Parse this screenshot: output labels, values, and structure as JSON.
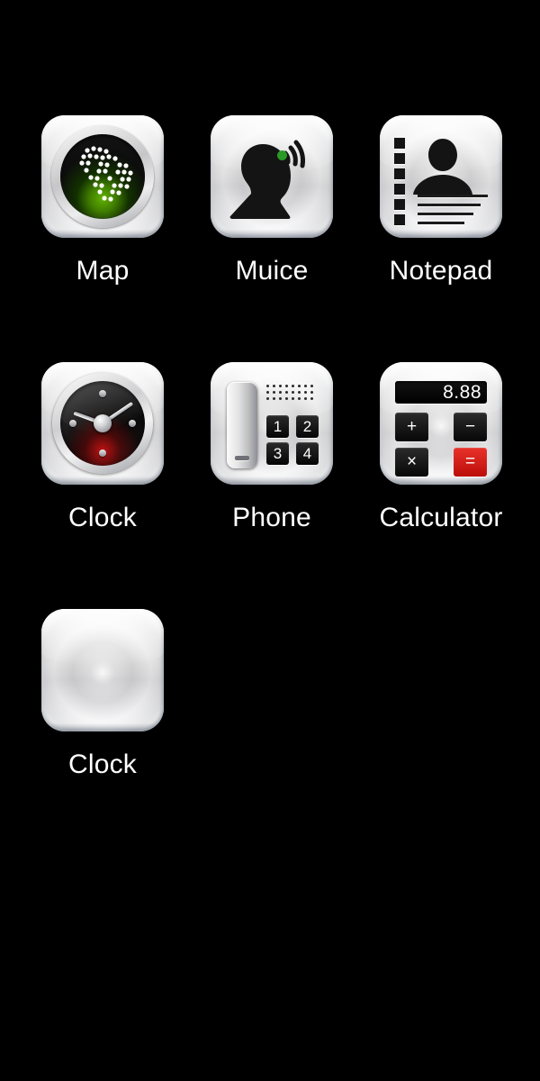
{
  "screen": {
    "name": "app-launcher-home-screen",
    "background_color": "#000000",
    "label_color": "#ffffff"
  },
  "apps": [
    {
      "id": "map",
      "label": "Map",
      "icon": "map-globe-radar-icon",
      "icon_accent_color": "#63b100"
    },
    {
      "id": "muice",
      "label": "Muice",
      "icon": "voice-person-soundwave-icon",
      "icon_accent_color": "#2a9a27"
    },
    {
      "id": "notepad",
      "label": "Notepad",
      "icon": "notepad-contact-card-icon",
      "icon_accent_color": "#1b1b1b"
    },
    {
      "id": "clock",
      "label": "Clock",
      "icon": "clock-analog-face-icon",
      "icon_accent_color": "#c61212"
    },
    {
      "id": "phone",
      "label": "Phone",
      "icon": "phone-desk-handset-icon",
      "icon_accent_color": "#050505",
      "keypad": [
        "1",
        "2",
        "3",
        "4"
      ]
    },
    {
      "id": "calculator",
      "label": "Calculator",
      "icon": "calculator-icon",
      "icon_accent_color": "#e8322b",
      "display_value": "8.88",
      "keys": [
        "+",
        "−",
        "×",
        "="
      ]
    },
    {
      "id": "clock-blank",
      "label": "Clock",
      "icon": "blank-brushed-metal-icon",
      "icon_accent_color": "#c9c9cb"
    }
  ]
}
